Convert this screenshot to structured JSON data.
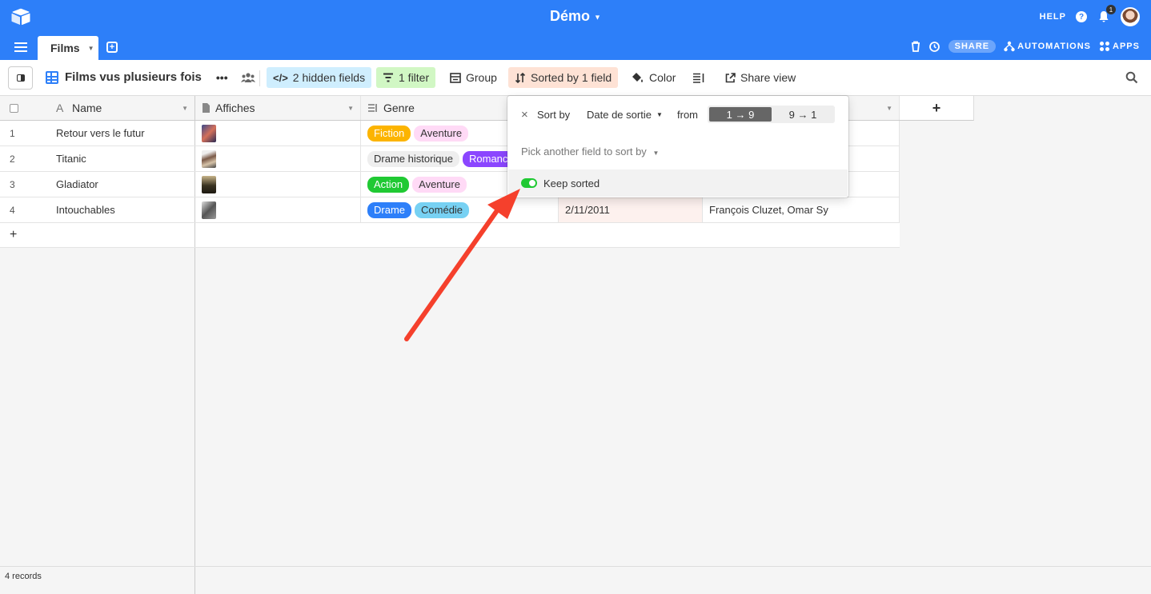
{
  "app": {
    "base_name": "Démo",
    "help_label": "HELP",
    "notification_count": "1"
  },
  "tabs": {
    "active_table": "Films",
    "share_label": "SHARE",
    "automations_label": "AUTOMATIONS",
    "apps_label": "APPS"
  },
  "toolbar": {
    "view_name": "Films vus plusieurs fois",
    "hidden_fields": "2 hidden fields",
    "filter": "1 filter",
    "group": "Group",
    "sorted": "Sorted by 1 field",
    "color": "Color",
    "share_view": "Share view"
  },
  "grid": {
    "columns": {
      "name": "Name",
      "affiches": "Affiches",
      "genre": "Genre",
      "add_col": "+"
    },
    "rows": [
      {
        "num": "1",
        "name": "Retour vers le futur",
        "genres": [
          "Fiction",
          "Aventure"
        ],
        "date": "",
        "actors": ""
      },
      {
        "num": "2",
        "name": "Titanic",
        "genres": [
          "Drame historique",
          "Romance"
        ],
        "date": "",
        "actors": ""
      },
      {
        "num": "3",
        "name": "Gladiator",
        "genres": [
          "Action",
          "Aventure"
        ],
        "date": "",
        "actors": ""
      },
      {
        "num": "4",
        "name": "Intouchables",
        "genres": [
          "Drame",
          "Comédie"
        ],
        "date": "2/11/2011",
        "actors": "François Cluzet, Omar Sy"
      }
    ],
    "add_row": "+"
  },
  "genre_colors": {
    "Fiction": {
      "bg": "#fcb400",
      "fg": "#ffffff"
    },
    "Aventure": {
      "bg": "#ffdaf6",
      "fg": "#333333"
    },
    "Drame historique": {
      "bg": "#eeeeee",
      "fg": "#333333"
    },
    "Romance": {
      "bg": "#8b46ff",
      "fg": "#ffffff"
    },
    "Action": {
      "bg": "#20c933",
      "fg": "#ffffff"
    },
    "Drame": {
      "bg": "#2d7ff9",
      "fg": "#ffffff"
    },
    "Comédie": {
      "bg": "#77d1f3",
      "fg": "#333333"
    }
  },
  "sort_popover": {
    "sort_by": "Sort by",
    "field": "Date de sortie",
    "from": "from",
    "ascending": "1 → 9",
    "descending": "9 → 1",
    "pick_another": "Pick another field to sort by",
    "keep_sorted": "Keep sorted",
    "keep_sorted_on": true
  },
  "footer": {
    "record_count": "4 records"
  },
  "colors": {
    "brand_blue": "#2d7ff9",
    "arrow_red": "#f5402c"
  }
}
